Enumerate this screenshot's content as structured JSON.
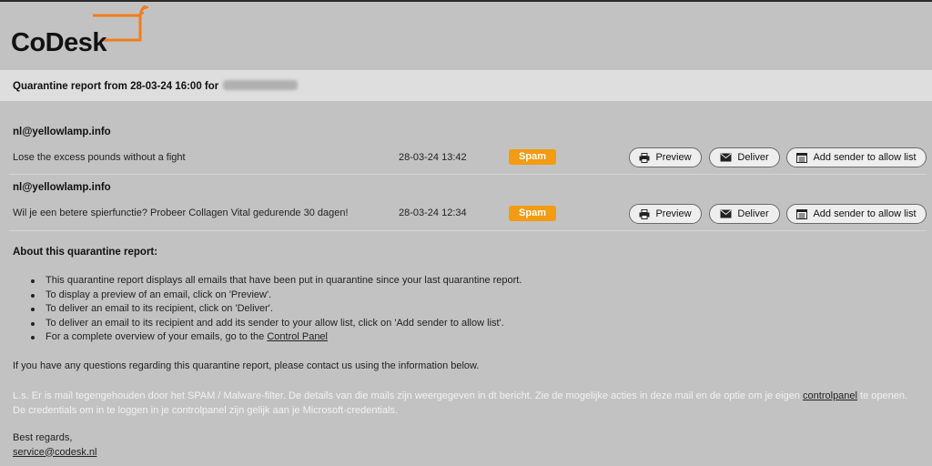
{
  "brand": {
    "name": "CoDesk",
    "accent_color": "#f07d1f",
    "badge_color": "#f39b12"
  },
  "report": {
    "title_prefix": "Quarantine report from 28-03-24 16:00 for"
  },
  "messages": [
    {
      "sender": "nl@yellowlamp.info",
      "subject": "Lose the excess pounds without a fight",
      "date": "28-03-24 13:42",
      "category": "Spam"
    },
    {
      "sender": "nl@yellowlamp.info",
      "subject": "Wil je een betere spierfunctie? Probeer Collagen Vital gedurende 30 dagen!",
      "date": "28-03-24 12:34",
      "category": "Spam"
    }
  ],
  "actions": {
    "preview_label": "Preview",
    "preview_icon": "printer-icon",
    "deliver_label": "Deliver",
    "deliver_icon": "envelope-icon",
    "allow_label": "Add sender to allow list",
    "allow_icon": "list-icon"
  },
  "about": {
    "heading": "About this quarantine report:",
    "items": [
      "This quarantine report displays all emails that have been put in quarantine since your last quarantine report.",
      "To display a preview of an email, click on 'Preview'.",
      "To deliver an email to its recipient, click on 'Deliver'.",
      "To deliver an email to its recipient and add its sender to your allow list, click on 'Add sender to allow list'."
    ],
    "overview_text": "For a complete overview of your emails, go to the",
    "overview_link": "Control Panel"
  },
  "contact_text": "If you have any questions regarding this quarantine report, please contact us using the information below.",
  "dutch_note": {
    "before": "L.s. Er is mail tegengehouden door het SPAM / Malware-filter. De details van die mails zijn weergegeven in dt bericht. Zie de mogelijke acties in deze mail en de optie om je eigen",
    "link": "controlpanel",
    "after": "te openen. De credentials om in te loggen in je controlpanel zijn gelijk aan je Microsoft-credentials."
  },
  "signature": {
    "regards": "Best regards,",
    "email": "service@codesk.nl"
  }
}
